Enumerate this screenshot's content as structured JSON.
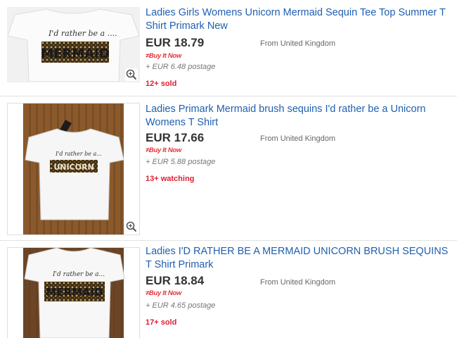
{
  "listings": [
    {
      "title": "Ladies Girls Womens Unicorn Mermaid Sequin Tee Top Summer T Shirt Primark New",
      "price": "EUR 18.79",
      "origin": "From United Kingdom",
      "buy_it_now": "Buy It Now",
      "postage": "+ EUR 6.48 postage",
      "status": "12+ sold",
      "image": {
        "script_text": "I'd rather be a ....",
        "sequin_text": "MERMAID",
        "background": "#f2f2f2"
      }
    },
    {
      "title": "Ladies Primark Mermaid brush sequins I'd rather be a Unicorn Womens T Shirt",
      "price": "EUR 17.66",
      "origin": "From United Kingdom",
      "buy_it_now": "Buy It Now",
      "postage": "+ EUR 5.88 postage",
      "status": "13+ watching",
      "image": {
        "script_text": "I'd rather be a...",
        "sequin_text": "UNICORN",
        "background": "#8a5a2e"
      }
    },
    {
      "title": "Ladies I'D RATHER BE A MERMAID UNICORN BRUSH SEQUINS T Shirt Primark",
      "price": "EUR 18.84",
      "origin": "From United Kingdom",
      "buy_it_now": "Buy It Now",
      "postage": "+ EUR 4.65 postage",
      "status": "17+ sold",
      "image": {
        "script_text": "I'd rather be a...",
        "sequin_text": "MERMAID",
        "background": "#6b4526"
      }
    }
  ],
  "colors": {
    "title_link": "#1f5fb0",
    "status_red": "#dd1e31",
    "price": "#333333"
  }
}
